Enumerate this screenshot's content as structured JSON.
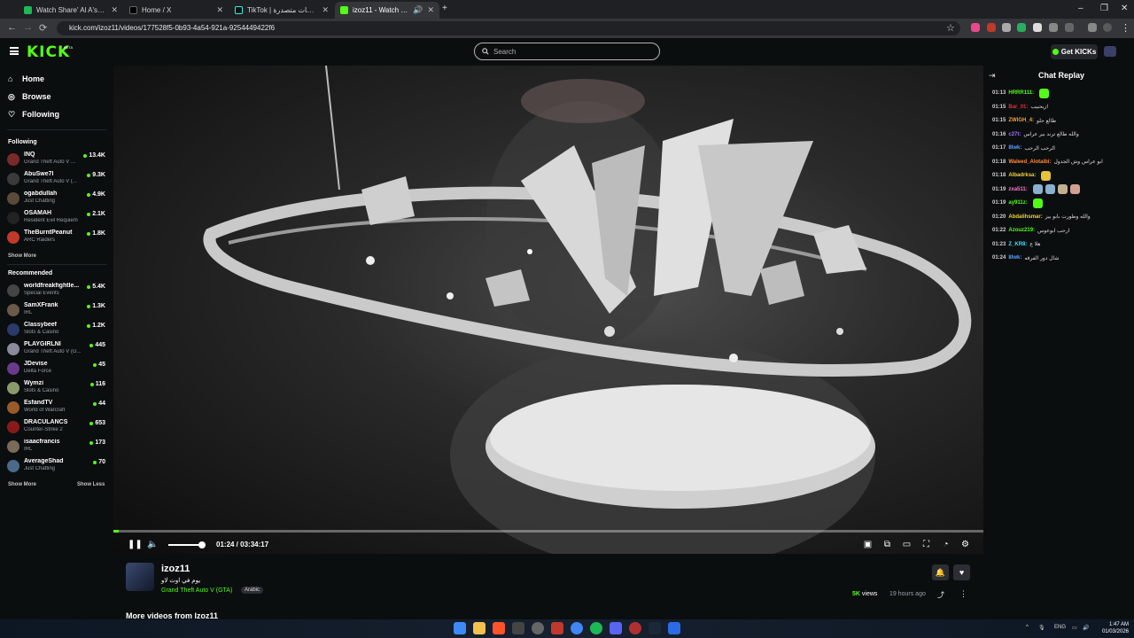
{
  "browser": {
    "tabs": [
      {
        "title": "Watch Share' Al A'sha - Season",
        "color": "#1db954",
        "active": false
      },
      {
        "title": "Home / X",
        "color": "#000000",
        "active": false
      },
      {
        "title": "TikTok | شاهد فيديوهات متصدرة",
        "color": "#111111",
        "active": false
      },
      {
        "title": "izoz11 - Watch the VOD on",
        "color": "#53fc18",
        "active": true
      }
    ],
    "new_tab": "+",
    "url": "kick.com/izoz11/videos/177528f5-0b93-4a54-921a-9254449422f6"
  },
  "header": {
    "logo": "KICK",
    "logo_badge": "BETA",
    "search_placeholder": "Search",
    "get_kicks": "Get KICKs"
  },
  "sidebar": {
    "nav": [
      {
        "label": "Home",
        "icon": "home-icon"
      },
      {
        "label": "Browse",
        "icon": "compass-icon"
      },
      {
        "label": "Following",
        "icon": "heart-icon"
      }
    ],
    "following_title": "Following",
    "following": [
      {
        "name": "INQ",
        "category": "Grand Theft Auto V ...",
        "viewers": "13.4K",
        "color": "#7a2a2a"
      },
      {
        "name": "AbuSwe7l",
        "category": "Grand Theft Auto V (...",
        "viewers": "9.3K",
        "color": "#3a3a3a"
      },
      {
        "name": "ogabdullah",
        "category": "Just Chatting",
        "viewers": "4.9K",
        "color": "#5a4a3a"
      },
      {
        "name": "OSAMAH",
        "category": "Resident Evil Requiem",
        "viewers": "2.1K",
        "color": "#222222"
      },
      {
        "name": "TheBurntPeanut",
        "category": "ARC Raiders",
        "viewers": "1.8K",
        "color": "#c0392b"
      }
    ],
    "show_more": "Show More",
    "recommended_title": "Recommended",
    "recommended": [
      {
        "name": "worldfreakfightle...",
        "category": "Special Events",
        "viewers": "5.4K",
        "color": "#444444"
      },
      {
        "name": "SamXFrank",
        "category": "IRL",
        "viewers": "1.3K",
        "color": "#6a5a4a"
      },
      {
        "name": "Classybeef",
        "category": "Slots & Casino",
        "viewers": "1.2K",
        "color": "#2a3a6a"
      },
      {
        "name": "PLAYGIRLNI",
        "category": "Grand Theft Auto V (G...",
        "viewers": "445",
        "color": "#8a8a9a"
      },
      {
        "name": "JDevise",
        "category": "Delta Force",
        "viewers": "45",
        "color": "#6a3a8a"
      },
      {
        "name": "Wymzi",
        "category": "Slots & Casino",
        "viewers": "116",
        "color": "#8a9a6a"
      },
      {
        "name": "EsfandTV",
        "category": "World of Warcraft",
        "viewers": "44",
        "color": "#9a5a2a"
      },
      {
        "name": "DRACULANCS",
        "category": "Counter-Strike 2",
        "viewers": "653",
        "color": "#8a1a1a"
      },
      {
        "name": "isaacfrancis",
        "category": "IRL",
        "viewers": "173",
        "color": "#7a6a5a"
      },
      {
        "name": "AverageShad",
        "category": "Just Chatting",
        "viewers": "70",
        "color": "#4a6a8a"
      }
    ],
    "show_more_2": "Show More",
    "show_less": "Show Less"
  },
  "player": {
    "time": "01:24 / 03:34:17",
    "progress": 0.0066,
    "volume": 0.95
  },
  "chat": {
    "title": "Chat Replay",
    "messages": [
      {
        "ts": "01:13",
        "user": "HRRR111:",
        "color": "#53fc18",
        "text": "",
        "emotes": [
          "#53fc18"
        ]
      },
      {
        "ts": "01:15",
        "user": "Bar_01:",
        "color": "#e03030",
        "text": "ازيحبيب",
        "emotes": []
      },
      {
        "ts": "01:15",
        "user": "ZWIGH_4:",
        "color": "#f2a03d",
        "text": "طالع حلو",
        "emotes": []
      },
      {
        "ts": "01:16",
        "user": "c27t:",
        "color": "#a070ff",
        "text": "والله طالع ترند بير عراس",
        "emotes": []
      },
      {
        "ts": "01:17",
        "user": "8lwk:",
        "color": "#5aa0ff",
        "text": "الرحب الرحب",
        "emotes": []
      },
      {
        "ts": "01:18",
        "user": "Waleed_Alotaibi:",
        "color": "#ff8a3d",
        "text": "ابو عراس وش الجدول",
        "emotes": []
      },
      {
        "ts": "01:18",
        "user": "Albadrksa:",
        "color": "#f2d43d",
        "text": "",
        "emotes": [
          "#e8c23a"
        ]
      },
      {
        "ts": "01:19",
        "user": "zxa511:",
        "color": "#ff7ad0",
        "text": "",
        "emotes": [
          "#8ab0d0",
          "#8ab0d0",
          "#c0b090",
          "#d0a090"
        ]
      },
      {
        "ts": "01:19",
        "user": "ay911z:",
        "color": "#53fc18",
        "text": "",
        "emotes": [
          "#53fc18"
        ]
      },
      {
        "ts": "01:20",
        "user": "Abdalihsmar:",
        "color": "#f2d43d",
        "text": "والله وطورت بابو بيز",
        "emotes": []
      },
      {
        "ts": "01:22",
        "user": "Azouz219:",
        "color": "#53fc18",
        "text": "ارحب ابوعوس",
        "emotes": []
      },
      {
        "ts": "01:23",
        "user": "Z_KR8:",
        "color": "#3ddcff",
        "text": "هلا ع",
        "emotes": []
      },
      {
        "ts": "01:24",
        "user": "8lwk:",
        "color": "#5aa0ff",
        "text": "شال دور الفرقه",
        "emotes": []
      }
    ]
  },
  "video_info": {
    "streamer": "izoz11",
    "title": "يوم في اوت لاو",
    "category": "Grand Theft Auto V (GTA)",
    "language": "Arabic",
    "views": "5K",
    "views_label": "views",
    "age": "19 hours ago",
    "more_videos": "More videos from Izoz11"
  },
  "taskbar": {
    "lang": "ENG",
    "time": "1:47 AM",
    "date": "01/03/2026"
  }
}
